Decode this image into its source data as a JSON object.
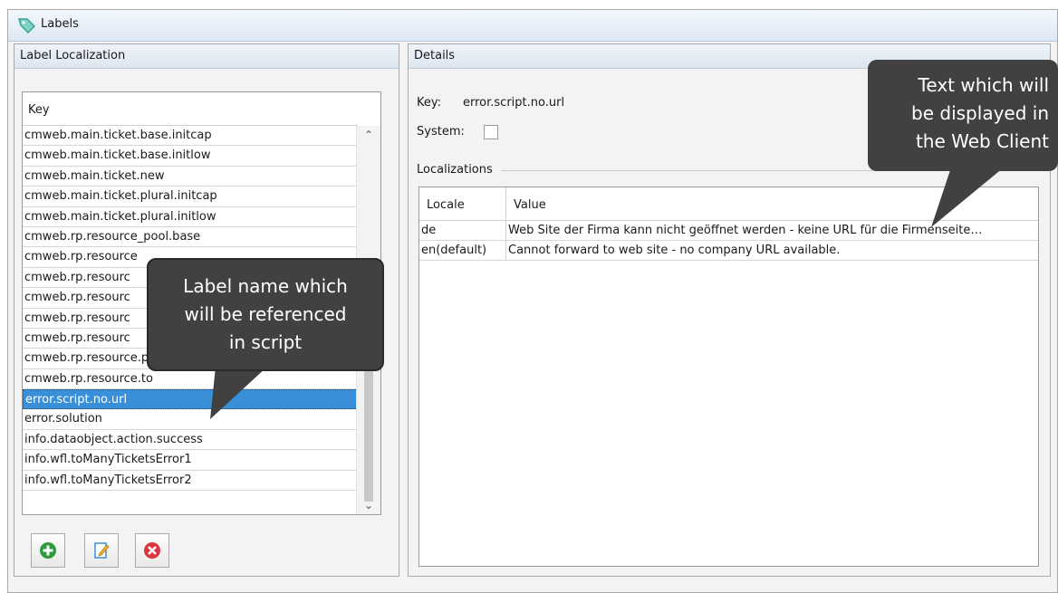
{
  "window": {
    "title": "Labels"
  },
  "left_panel": {
    "title": "Label Localization",
    "column_header": "Key",
    "keys": [
      "cmweb.main.ticket.base.initcap",
      "cmweb.main.ticket.base.initlow",
      "cmweb.main.ticket.new",
      "cmweb.main.ticket.plural.initcap",
      "cmweb.main.ticket.plural.initlow",
      "cmweb.rp.resource_pool.base",
      "cmweb.rp.resource",
      "cmweb.rp.resourc",
      "cmweb.rp.resourc",
      "cmweb.rp.resourc",
      "cmweb.rp.resourc",
      "cmweb.rp.resource.plural",
      "cmweb.rp.resource.to",
      "error.script.no.url",
      "error.solution",
      "info.dataobject.action.success",
      "info.wfl.toManyTicketsError1",
      "info.wfl.toManyTicketsError2"
    ],
    "selected_key": "error.script.no.url",
    "buttons": {
      "add": "add-icon",
      "edit": "edit-icon",
      "delete": "delete-icon"
    }
  },
  "details_panel": {
    "title": "Details",
    "key_label": "Key:",
    "key_value": "error.script.no.url",
    "system_label": "System:",
    "system_checked": false,
    "localizations_label": "Localizations",
    "columns": [
      "Locale",
      "Value"
    ],
    "rows": [
      {
        "locale": "de",
        "value": "Web Site der Firma kann nicht geöffnet werden - keine URL für die Firmenseite…"
      },
      {
        "locale": "en(default)",
        "value": "Cannot forward to web site - no company URL available."
      }
    ]
  },
  "callouts": {
    "left": [
      "Label name which",
      "will be referenced",
      "in script"
    ],
    "right": [
      "Text which will",
      "be displayed in",
      "the Web Client"
    ]
  },
  "colors": {
    "selection": "#3a8fd9",
    "callout_bg": "#414141",
    "add": "#2e9b3b",
    "delete": "#d9363e"
  }
}
